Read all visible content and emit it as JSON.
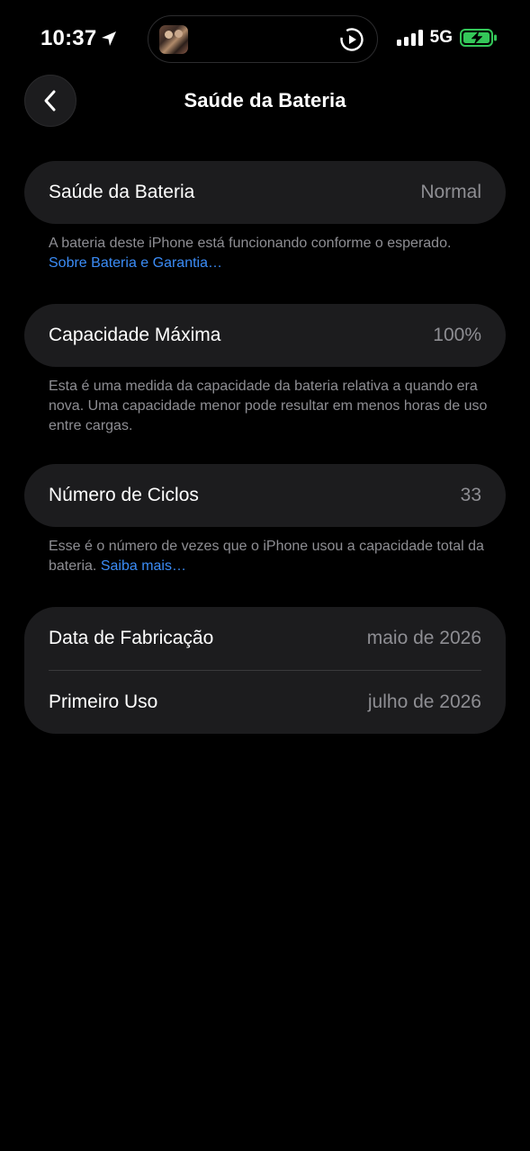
{
  "status_bar": {
    "time": "10:37",
    "network": "5G",
    "icons": [
      "location-arrow-icon",
      "signal-bars-icon",
      "battery-charging-icon",
      "play-circle-icon"
    ]
  },
  "nav": {
    "title": "Saúde da Bateria",
    "back_icon": "chevron-left-icon"
  },
  "sections": {
    "health": {
      "label": "Saúde da Bateria",
      "value": "Normal",
      "footnote": "A bateria deste iPhone está funcionando conforme o esperado.",
      "link": "Sobre Bateria e Garantia…"
    },
    "capacity": {
      "label": "Capacidade Máxima",
      "value": "100%",
      "footnote": "Esta é uma medida da capacidade da bateria relativa a quando era nova. Uma capacidade menor pode resultar em menos horas de uso entre cargas."
    },
    "cycles": {
      "label": "Número de Ciclos",
      "value": "33",
      "footnote": "Esse é o número de vezes que o iPhone usou a capacidade total da bateria.",
      "link": "Saiba mais…"
    },
    "dates": {
      "manufacture_label": "Data de Fabricação",
      "manufacture_value": "maio de 2026",
      "first_use_label": "Primeiro Uso",
      "first_use_value": "julho de 2026"
    }
  },
  "colors": {
    "background": "#000000",
    "card": "#1c1c1e",
    "secondary_text": "#8e8e93",
    "link": "#3b8cf6",
    "battery_green": "#34c759"
  }
}
